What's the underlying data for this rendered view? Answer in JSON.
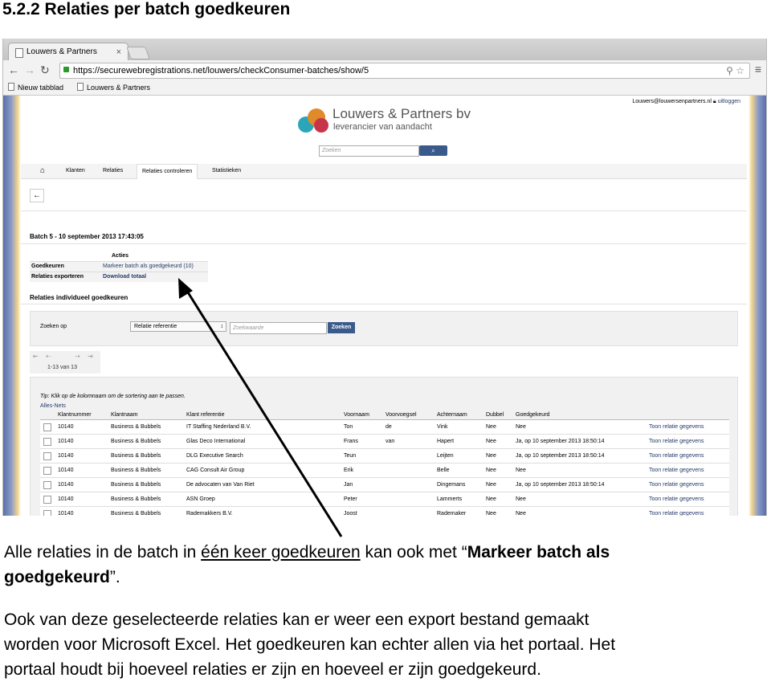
{
  "doc": {
    "heading": "5.2.2 Relaties per batch goedkeuren",
    "para1": {
      "pre": "Alle relaties in de batch in ",
      "underline": "één keer goedkeuren",
      "mid": " kan ook met “",
      "bold1": "Markeer batch als",
      "bold2": "goedgekeurd",
      "post": "”."
    },
    "para2": {
      "line1": "Ook van deze geselecteerde relaties kan er weer een export bestand gemaakt",
      "line2": "worden voor Microsoft Excel. Het goedkeuren kan echter allen via het portaal. Het",
      "line3": "portaal houdt bij hoeveel relaties er zijn en hoeveel er zijn goedgekeurd."
    }
  },
  "browser": {
    "tab_title": "Louwers & Partners",
    "tab_close": "×",
    "url_https": "https://",
    "url_rest": "https://securewebregistrations.net/louwers/checkConsumer-batches/show/5",
    "bookmarks": [
      "Nieuw tabblad",
      "Louwers & Partners"
    ]
  },
  "site": {
    "user_email": "Louwers@louwersenpartners.nl",
    "logout": "uitloggen",
    "brand_name": "Louwers & Partners bv",
    "brand_tagline": "leverancier van aandacht",
    "search_placeholder": "Zoeken",
    "nav": [
      "Klanten",
      "Relaties",
      "Relaties controleren",
      "Statistieken"
    ],
    "batch_title": "Batch 5 - 10 september 2013 17:43:05",
    "acties_header": "Acties",
    "acties": [
      {
        "label": "Goedkeuren",
        "action": "Markeer batch als goedgekeurd (10)"
      },
      {
        "label": "Relaties exporteren",
        "action": "Download totaal"
      }
    ],
    "section_title": "Relaties individueel goedkeuren",
    "filter": {
      "label": "Zoeken op",
      "select_value": "Relatie referentie",
      "input_placeholder": "Zoekwaarde",
      "button": "Zoeken"
    },
    "pager": {
      "first": "⇤",
      "prev": "⇠",
      "next": "⇢",
      "last": "⇥",
      "count": "1-13 van 13"
    },
    "tip": "Tip: Klik op de kolomnaam om de sortering aan te passen.",
    "all_nets": "Alles-Nets",
    "columns": [
      "Klantnummer",
      "Klantnaam",
      "Klant referentie",
      "Voornaam",
      "Voorvoegsel",
      "Achternaam",
      "Dubbel",
      "Goedgekeurd"
    ],
    "rows": [
      [
        "10140",
        "Business & Bubbels",
        "IT Staffing Nederland B.V.",
        "Ton",
        "de",
        "Vink",
        "Nee",
        "Nee",
        "Toon relatie gegevens"
      ],
      [
        "10140",
        "Business & Bubbels",
        "Glas Deco International",
        "Frans",
        "van",
        "Hapert",
        "Nee",
        "Ja, op 10 september 2013 18:50:14",
        "Toon relatie gegevens"
      ],
      [
        "10140",
        "Business & Bubbels",
        "DLG Executive Search",
        "Teun",
        "",
        "Leijten",
        "Nee",
        "Ja, op 10 september 2013 18:50:14",
        "Toon relatie gegevens"
      ],
      [
        "10140",
        "Business & Bubbels",
        "CAG Consult Air Group",
        "Erik",
        "",
        "Belle",
        "Nee",
        "Nee",
        "Toon relatie gegevens"
      ],
      [
        "10140",
        "Business & Bubbels",
        "De advocaten van Van Riet",
        "Jan",
        "",
        "Dingemans",
        "Nee",
        "Ja, op 10 september 2013 18:50:14",
        "Toon relatie gegevens"
      ],
      [
        "10140",
        "Business & Bubbels",
        "ASN Groep",
        "Peter",
        "",
        "Lammerts",
        "Nee",
        "Nee",
        "Toon relatie gegevens"
      ],
      [
        "10140",
        "Business & Bubbels",
        "Rademakkers B.V.",
        "Joost",
        "",
        "Rademaker",
        "Nee",
        "Nee",
        "Toon relatie gegevens"
      ]
    ]
  }
}
